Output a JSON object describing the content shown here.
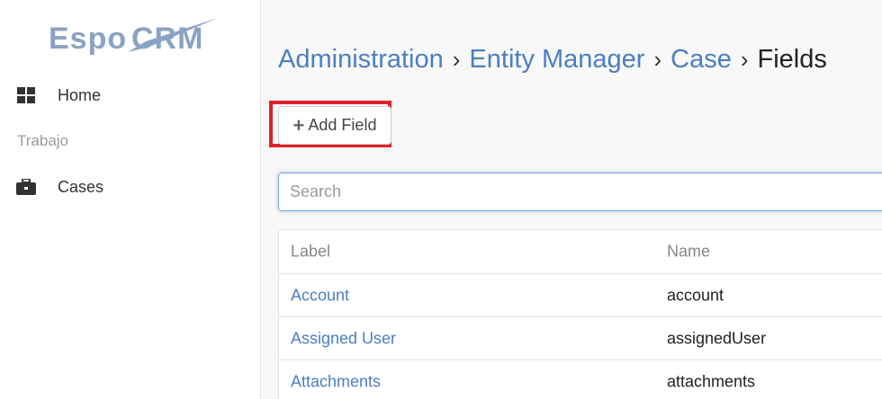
{
  "brand": {
    "logo_text": "EspoCRM"
  },
  "sidebar": {
    "items": [
      {
        "label": "Home",
        "icon": "th-large-icon"
      },
      {
        "label": "Cases",
        "icon": "briefcase-icon"
      }
    ],
    "group_label": "Trabajo"
  },
  "breadcrumb": {
    "items": [
      "Administration",
      "Entity Manager",
      "Case"
    ],
    "current": "Fields",
    "separator": "›"
  },
  "toolbar": {
    "add_field_label": "Add Field",
    "add_icon": "plus-icon"
  },
  "search": {
    "placeholder": "Search",
    "value": ""
  },
  "table": {
    "columns": [
      "Label",
      "Name"
    ],
    "rows": [
      {
        "label": "Account",
        "name": "account"
      },
      {
        "label": "Assigned User",
        "name": "assignedUser"
      },
      {
        "label": "Attachments",
        "name": "attachments"
      }
    ]
  },
  "colors": {
    "link": "#4a7fc1",
    "highlight": "#e0202a",
    "logo": "#8aa3c4"
  }
}
